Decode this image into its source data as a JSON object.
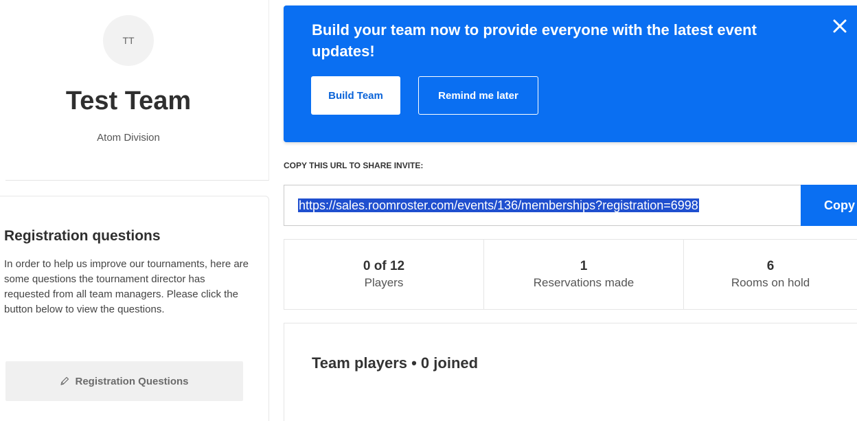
{
  "team": {
    "initials": "TT",
    "name": "Test Team",
    "division": "Atom Division"
  },
  "registration": {
    "title": "Registration questions",
    "description": "In order to help us improve our tournaments, here are some questions the tournament director has requested from all team managers. Please click the button below to view the questions.",
    "button_label": "Registration Questions",
    "button_icon": "pencil-icon"
  },
  "banner": {
    "message": "Build your team now to provide everyone with the latest event updates!",
    "build_label": "Build Team",
    "remind_label": "Remind me later",
    "close_icon": "close-icon"
  },
  "invite": {
    "label": "COPY THIS URL TO SHARE INVITE:",
    "url": "https://sales.roomroster.com/events/136/memberships?registration=6998",
    "copy_label": "Copy"
  },
  "stats": [
    {
      "value": "0 of 12",
      "label": "Players"
    },
    {
      "value": "1",
      "label": "Reservations made"
    },
    {
      "value": "6",
      "label": "Rooms on hold"
    }
  ],
  "players": {
    "title": "Team players • 0 joined"
  },
  "colors": {
    "primary": "#0a6ff2",
    "selection": "#1f4fcf",
    "button_gray": "#f0f0f0"
  }
}
